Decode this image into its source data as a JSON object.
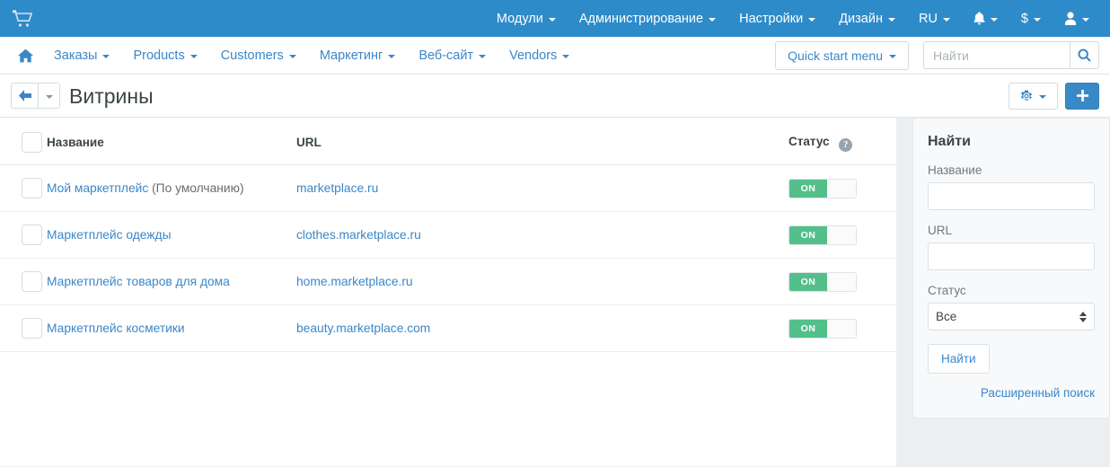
{
  "topbar": {
    "brand_icon": "cart-icon",
    "menus": [
      {
        "label": "Модули",
        "icon": null
      },
      {
        "label": "Администрирование",
        "icon": null
      },
      {
        "label": "Настройки",
        "icon": null
      },
      {
        "label": "Дизайн",
        "icon": null
      },
      {
        "label": "RU",
        "icon": null
      },
      {
        "label": "",
        "icon": "bell-icon"
      },
      {
        "label": "$",
        "icon": null
      },
      {
        "label": "",
        "icon": "user-icon"
      }
    ],
    "bg_color": "#2e8bc9"
  },
  "subnav": {
    "home_icon": "home-icon",
    "items": [
      {
        "label": "Заказы"
      },
      {
        "label": "Products"
      },
      {
        "label": "Customers"
      },
      {
        "label": "Маркетинг"
      },
      {
        "label": "Веб-сайт"
      },
      {
        "label": "Vendors"
      }
    ],
    "quick_start_label": "Quick start menu",
    "search_placeholder": "Найти",
    "search_value": "",
    "link_color": "#3a87c8"
  },
  "titlebar": {
    "back_icon": "arrow-left-icon",
    "title": "Витрины",
    "gear_icon": "gear-icon",
    "add_icon": "plus-icon"
  },
  "table": {
    "select_all_checked": false,
    "columns": [
      {
        "key": "name",
        "label": "Название"
      },
      {
        "key": "url",
        "label": "URL"
      },
      {
        "key": "status",
        "label": "Статус",
        "help": "?"
      }
    ],
    "rows": [
      {
        "checked": false,
        "name": "Мой маркетплейс",
        "name_suffix": "(По умолчанию)",
        "url": "marketplace.ru",
        "status": "ON"
      },
      {
        "checked": false,
        "name": "Маркетплейс одежды",
        "name_suffix": "",
        "url": "clothes.marketplace.ru",
        "status": "ON"
      },
      {
        "checked": false,
        "name": "Маркетплейс товаров для дома",
        "name_suffix": "",
        "url": "home.marketplace.ru",
        "status": "ON"
      },
      {
        "checked": false,
        "name": "Маркетплейс косметики",
        "name_suffix": "",
        "url": "beauty.marketplace.com",
        "status": "ON"
      }
    ],
    "toggle_on_color": "#53c08b"
  },
  "search_panel": {
    "title": "Найти",
    "name_label": "Название",
    "name_value": "",
    "url_label": "URL",
    "url_value": "",
    "status_label": "Статус",
    "status_value": "Все",
    "status_options": [
      "Все"
    ],
    "submit_label": "Найти",
    "advanced_label": "Расширенный поиск"
  }
}
